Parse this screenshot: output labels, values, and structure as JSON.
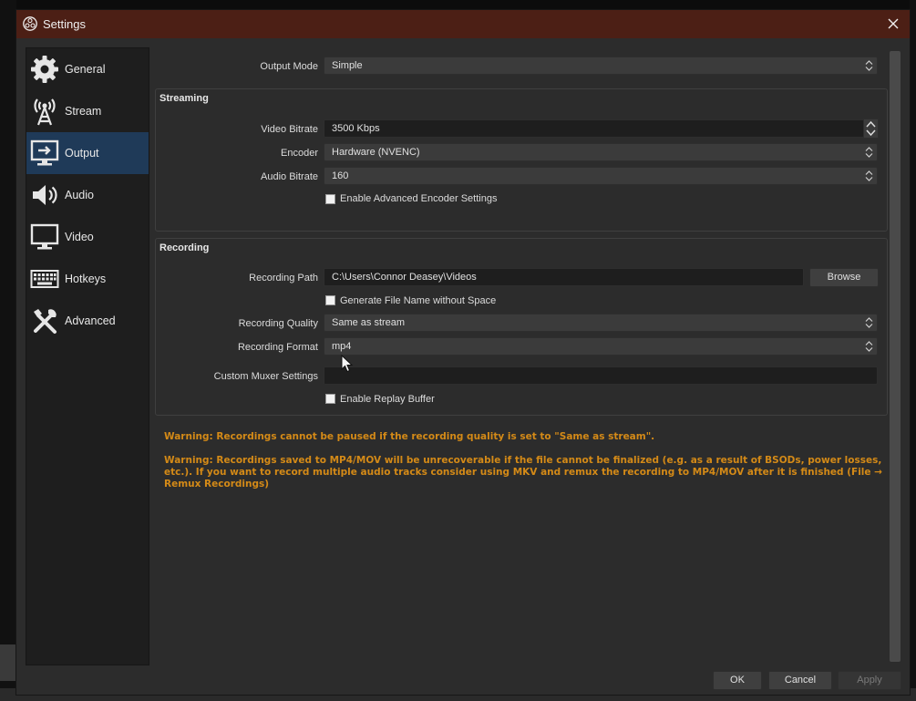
{
  "window": {
    "title": "Settings"
  },
  "sidebar": {
    "items": [
      {
        "label": "General",
        "icon": "gear-icon"
      },
      {
        "label": "Stream",
        "icon": "antenna-icon"
      },
      {
        "label": "Output",
        "icon": "output-monitor-icon",
        "active": true
      },
      {
        "label": "Audio",
        "icon": "speaker-icon"
      },
      {
        "label": "Video",
        "icon": "monitor-icon"
      },
      {
        "label": "Hotkeys",
        "icon": "keyboard-icon"
      },
      {
        "label": "Advanced",
        "icon": "tools-icon"
      }
    ]
  },
  "output_mode": {
    "label": "Output Mode",
    "value": "Simple"
  },
  "streaming": {
    "title": "Streaming",
    "video_bitrate": {
      "label": "Video Bitrate",
      "value": "3500 Kbps"
    },
    "encoder": {
      "label": "Encoder",
      "value": "Hardware (NVENC)"
    },
    "audio_bitrate": {
      "label": "Audio Bitrate",
      "value": "160"
    },
    "advanced_encoder": {
      "label": "Enable Advanced Encoder Settings",
      "checked": false
    }
  },
  "recording": {
    "title": "Recording",
    "path": {
      "label": "Recording Path",
      "value": "C:\\Users\\Connor Deasey\\Videos",
      "browse_label": "Browse"
    },
    "no_space": {
      "label": "Generate File Name without Space",
      "checked": false
    },
    "quality": {
      "label": "Recording Quality",
      "value": "Same as stream"
    },
    "format": {
      "label": "Recording Format",
      "value": "mp4"
    },
    "muxer": {
      "label": "Custom Muxer Settings",
      "value": ""
    },
    "replay_buffer": {
      "label": "Enable Replay Buffer",
      "checked": false
    }
  },
  "warnings": [
    "Warning: Recordings cannot be paused if the recording quality is set to \"Same as stream\".",
    "Warning: Recordings saved to MP4/MOV will be unrecoverable if the file cannot be finalized (e.g. as a result of BSODs, power losses, etc.). If you want to record multiple audio tracks consider using MKV and remux the recording to MP4/MOV after it is finished (File → Remux Recordings)"
  ],
  "footer": {
    "ok": "OK",
    "cancel": "Cancel",
    "apply": "Apply"
  },
  "colors": {
    "titlebar": "#4c1f15",
    "active_nav": "#1f3a58",
    "warning": "#d48a17"
  }
}
